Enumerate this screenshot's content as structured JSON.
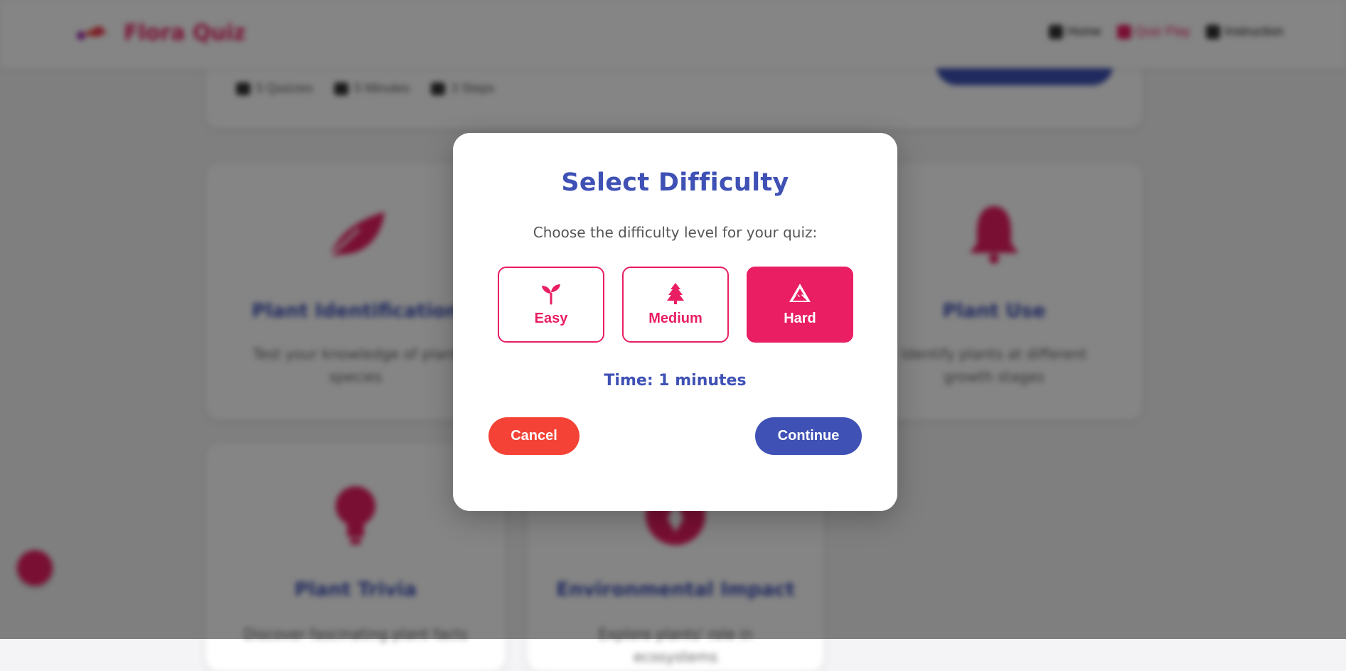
{
  "navbar": {
    "brand": "Flora Quiz",
    "links": [
      {
        "label": "Home",
        "icon": "home-icon"
      },
      {
        "label": "Quiz Play",
        "icon": "play-icon"
      },
      {
        "label": "Instruction",
        "icon": "info-icon"
      }
    ]
  },
  "stats": [
    {
      "label": "5 Quizzes",
      "icon": "question-icon"
    },
    {
      "label": "5 Minutes",
      "icon": "clock-icon"
    },
    {
      "label": "3 Steps",
      "icon": "steps-icon"
    }
  ],
  "cards": [
    {
      "title": "Plant Identification",
      "description": "Test your knowledge of plant species",
      "icon": "leaf-icon"
    },
    {
      "title": "Plant Use",
      "description": "Identify plants at different growth stages",
      "icon": "bell-icon"
    },
    {
      "title": "Plant Trivia",
      "description": "Discover fascinating plant facts",
      "icon": "lightbulb-icon"
    },
    {
      "title": "Environmental Impact",
      "description": "Explore plants' role in ecosystems",
      "icon": "globe-icon"
    }
  ],
  "modal": {
    "title": "Select Difficulty",
    "subtitle": "Choose the difficulty level for your quiz:",
    "options": [
      {
        "label": "Easy",
        "icon": "sprout-icon",
        "selected": false
      },
      {
        "label": "Medium",
        "icon": "tree-icon",
        "selected": false
      },
      {
        "label": "Hard",
        "icon": "mountain-icon",
        "selected": true
      }
    ],
    "time_label": "Time: 1 minutes",
    "cancel_label": "Cancel",
    "continue_label": "Continue"
  },
  "colors": {
    "primary": "#3f51b5",
    "accent": "#e91e63",
    "danger": "#f44336"
  }
}
